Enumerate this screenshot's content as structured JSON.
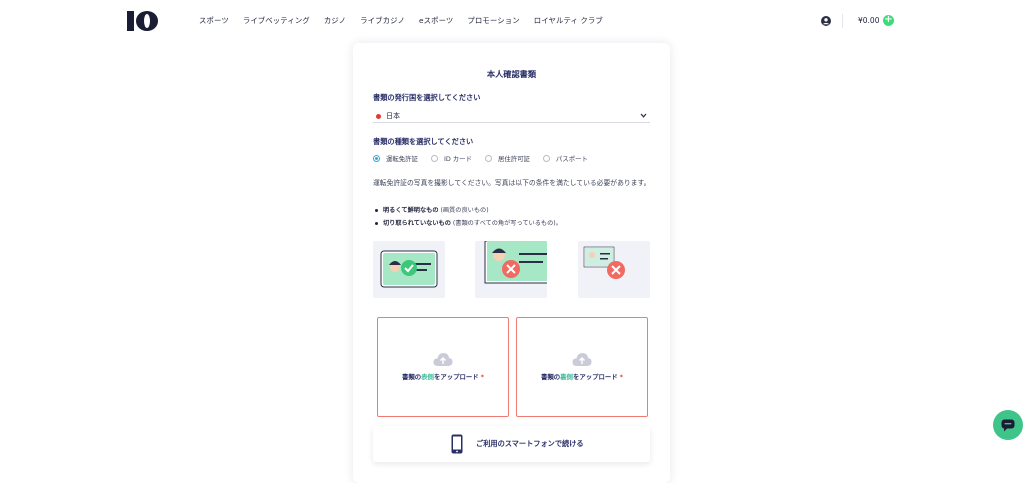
{
  "header": {
    "logo_text": "10",
    "nav": [
      "スポーツ",
      "ライブベッティング",
      "カジノ",
      "ライブカジノ",
      "eスポーツ",
      "プロモーション",
      "ロイヤルティ クラブ"
    ],
    "balance": "¥0.00",
    "add_funds_label": "+"
  },
  "form": {
    "title": "本人確認書類",
    "country_label": "書類の発行国を選択してください",
    "country_value": "日本",
    "doc_type_label": "書類の種類を選択してください",
    "doc_types": [
      "運転免許証",
      "ID カード",
      "居住許可証",
      "パスポート"
    ],
    "selected_doc_type": "運転免許証",
    "instructions": "運転免許証の写真を撮影してください。写真は以下の条件を満たしている必要があります。",
    "requirements": [
      {
        "bold": "明るくて鮮明なもの",
        "note": "(画質の良いもの)"
      },
      {
        "bold": "切り取られていないもの",
        "note": "(書類のすべての角が写っているもの)。"
      }
    ],
    "upload_front": {
      "pre": "書類の",
      "hl": "表側",
      "post": "をアップロード",
      "req": "*"
    },
    "upload_back": {
      "pre": "書類の",
      "hl": "裏側",
      "post": "をアップロード",
      "req": "*"
    },
    "phone_continue": "ご利用のスマートフォンで続ける"
  },
  "colors": {
    "accent": "#3ddc7a",
    "error": "#f07b74",
    "title": "#2a2f68",
    "highlight": "#3fbf9a"
  },
  "icons": {
    "user": "user-circle-icon",
    "chevron": "chevron-down-icon",
    "upload": "cloud-upload-icon",
    "phone": "smartphone-icon",
    "chat": "chat-bubble-icon"
  }
}
